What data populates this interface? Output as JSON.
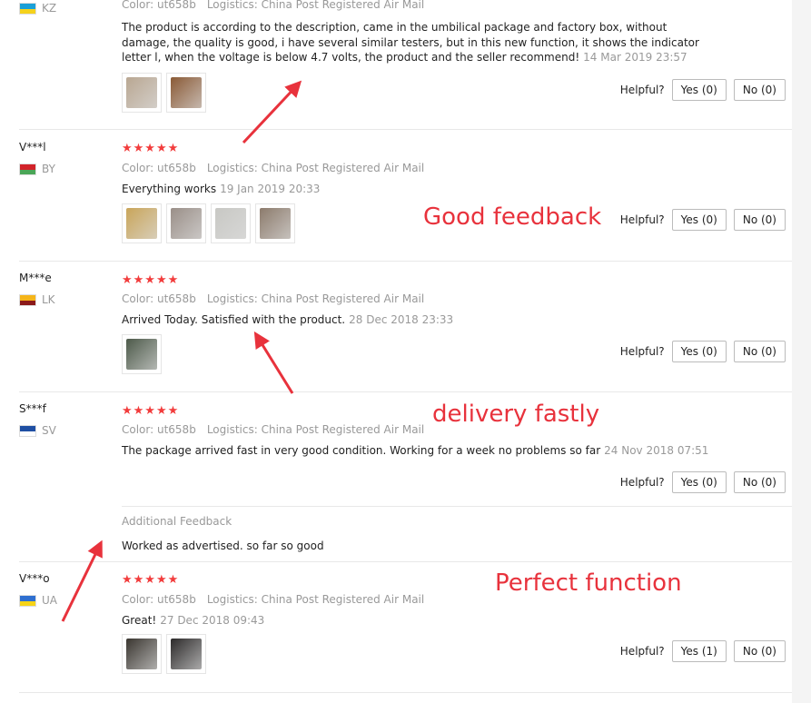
{
  "helpful_label": "Helpful?",
  "reviews": [
    {
      "name": "",
      "country": "KZ",
      "flag_colors": [
        "#1aa0d8",
        "#f5d21c"
      ],
      "stars": "★★★★★",
      "color": "Color: ut658b",
      "logistics": "Logistics: China Post Registered Air Mail",
      "text": "The product is according to the description, came in the umbilical package and factory box, without damage, the quality is good, i have several similar testers, but in this new function, it shows the indicator letter l, when the voltage is below 4.7 volts, the product and the seller recommend!",
      "date": "14 Mar 2019 23:57",
      "thumbs": [
        "#b9a792",
        "#8a5a36"
      ],
      "yes": "Yes (0)",
      "no": "No (0)"
    },
    {
      "name": "V***l",
      "country": "BY",
      "flag_colors": [
        "#d2232a",
        "#4aa657"
      ],
      "stars": "★★★★★",
      "color": "Color: ut658b",
      "logistics": "Logistics: China Post Registered Air Mail",
      "text": "Everything works",
      "date": "19 Jan 2019 20:33",
      "thumbs": [
        "#c9a55a",
        "#9a8f88",
        "#c8c8c4",
        "#8c7b6c"
      ],
      "yes": "Yes (0)",
      "no": "No (0)"
    },
    {
      "name": "M***e",
      "country": "LK",
      "flag_colors": [
        "#f5b51a",
        "#8b1a1a"
      ],
      "stars": "★★★★★",
      "color": "Color: ut658b",
      "logistics": "Logistics: China Post Registered Air Mail",
      "text": "Arrived Today. Satisfied with the product.",
      "date": "28 Dec 2018 23:33",
      "thumbs": [
        "#4d5a4a"
      ],
      "yes": "Yes (0)",
      "no": "No (0)"
    },
    {
      "name": "S***f",
      "country": "SV",
      "flag_colors": [
        "#1f4fa3",
        "#ffffff"
      ],
      "stars": "★★★★★",
      "color": "Color: ut658b",
      "logistics": "Logistics: China Post Registered Air Mail",
      "text": "The package arrived fast in very good condition. Working for a week no problems so far",
      "date": "24 Nov 2018 07:51",
      "thumbs": [],
      "yes": "Yes (0)",
      "no": "No (0)",
      "additional_label": "Additional Feedback",
      "additional_text": "Worked as advertised. so far so good"
    },
    {
      "name": "V***o",
      "country": "UA",
      "flag_colors": [
        "#2f6fd0",
        "#f7d417"
      ],
      "stars": "★★★★★",
      "color": "Color: ut658b",
      "logistics": "Logistics: China Post Registered Air Mail",
      "text": "Great!",
      "date": "27 Dec 2018 09:43",
      "thumbs": [
        "#3a3630",
        "#2c2a2a"
      ],
      "yes": "Yes (1)",
      "no": "No (0)"
    }
  ],
  "annotations": {
    "good": "Good feedback",
    "delivery": "delivery fastly",
    "perfect": "Perfect function",
    "color": "#e8323c"
  }
}
